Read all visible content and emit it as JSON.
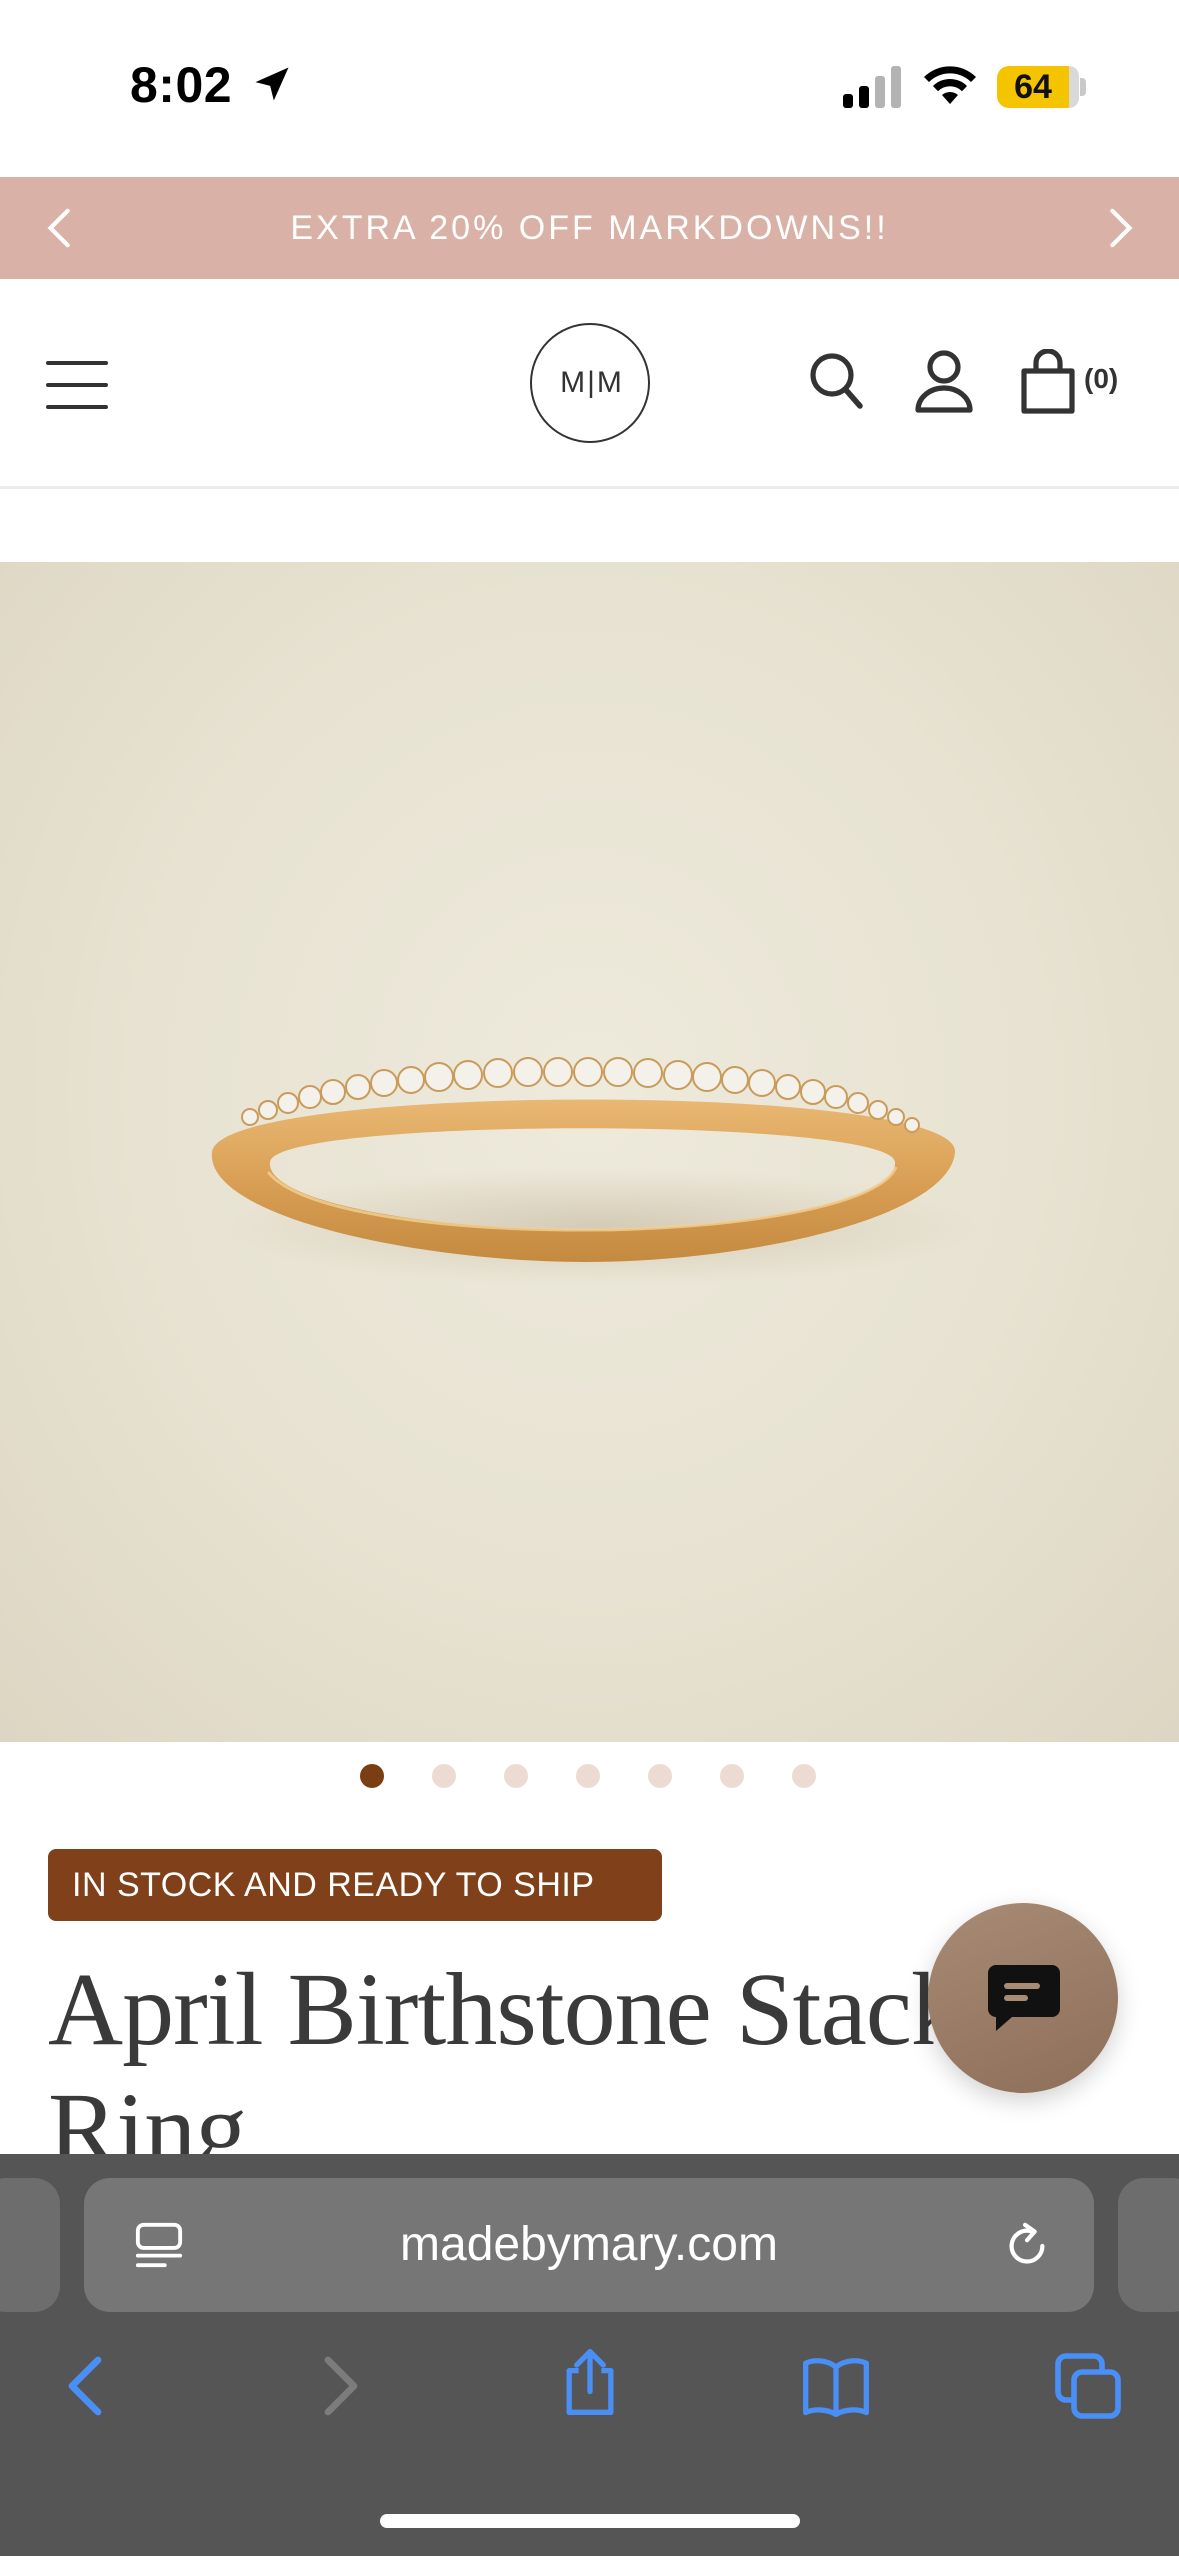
{
  "status_bar": {
    "time": "8:02",
    "battery_level": "64",
    "battery_color": "#f5c400"
  },
  "promo": {
    "text": "EXTRA 20% OFF MARKDOWNS!!",
    "background": "#d9b1a6"
  },
  "header": {
    "logo_text": "M|M",
    "cart_count": "(0)"
  },
  "carousel": {
    "total_images": 7,
    "active_index": 0
  },
  "product": {
    "stock_badge": "IN STOCK AND READY TO SHIP",
    "title": "April Birthstone Stacking Ring",
    "badge_color": "#80411a"
  },
  "browser": {
    "url": "madebymary.com"
  },
  "icons": {
    "location": "location-arrow-icon",
    "signal": "cellular-signal-icon",
    "wifi": "wifi-icon",
    "menu": "hamburger-menu-icon",
    "search": "search-icon",
    "account": "user-icon",
    "cart": "shopping-bag-icon",
    "chat": "chat-bubble-icon",
    "reader": "reader-mode-icon",
    "reload": "reload-icon",
    "back": "back-arrow-icon",
    "forward": "forward-arrow-icon",
    "share": "share-icon",
    "bookmarks": "bookmarks-icon",
    "tabs": "tabs-icon"
  },
  "colors": {
    "browser_accent": "#3b82f6"
  }
}
